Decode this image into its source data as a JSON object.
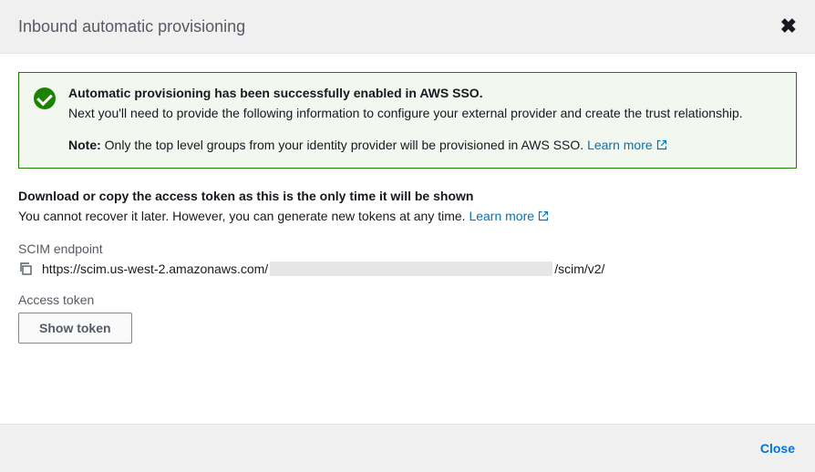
{
  "header": {
    "title": "Inbound automatic provisioning"
  },
  "alert": {
    "title": "Automatic provisioning has been successfully enabled in AWS SSO.",
    "description": "Next you'll need to provide the following information to configure your external provider and create the trust relationship.",
    "note_label": "Note:",
    "note_text": " Only the top level groups from your identity provider will be provisioned in AWS SSO. ",
    "learn_more": "Learn more"
  },
  "body": {
    "download_title": "Download or copy the access token as this is the only time it will be shown",
    "download_desc_prefix": "You cannot recover it later. However, you can generate new tokens at any time. ",
    "download_learn_more": "Learn more",
    "endpoint_label": "SCIM endpoint",
    "endpoint_prefix": "https://scim.us-west-2.amazonaws.com/",
    "endpoint_suffix": "/scim/v2/",
    "token_label": "Access token",
    "show_token_btn": "Show token"
  },
  "footer": {
    "close_btn": "Close"
  }
}
